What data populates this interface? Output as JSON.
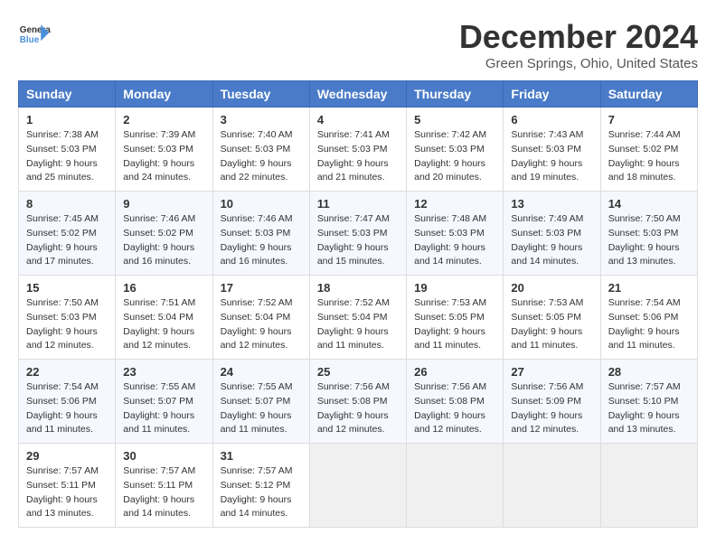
{
  "header": {
    "logo_general": "General",
    "logo_blue": "Blue",
    "month_title": "December 2024",
    "location": "Green Springs, Ohio, United States"
  },
  "days_of_week": [
    "Sunday",
    "Monday",
    "Tuesday",
    "Wednesday",
    "Thursday",
    "Friday",
    "Saturday"
  ],
  "weeks": [
    [
      {
        "day": "1",
        "sunrise": "7:38 AM",
        "sunset": "5:03 PM",
        "daylight": "9 hours and 25 minutes."
      },
      {
        "day": "2",
        "sunrise": "7:39 AM",
        "sunset": "5:03 PM",
        "daylight": "9 hours and 24 minutes."
      },
      {
        "day": "3",
        "sunrise": "7:40 AM",
        "sunset": "5:03 PM",
        "daylight": "9 hours and 22 minutes."
      },
      {
        "day": "4",
        "sunrise": "7:41 AM",
        "sunset": "5:03 PM",
        "daylight": "9 hours and 21 minutes."
      },
      {
        "day": "5",
        "sunrise": "7:42 AM",
        "sunset": "5:03 PM",
        "daylight": "9 hours and 20 minutes."
      },
      {
        "day": "6",
        "sunrise": "7:43 AM",
        "sunset": "5:03 PM",
        "daylight": "9 hours and 19 minutes."
      },
      {
        "day": "7",
        "sunrise": "7:44 AM",
        "sunset": "5:02 PM",
        "daylight": "9 hours and 18 minutes."
      }
    ],
    [
      {
        "day": "8",
        "sunrise": "7:45 AM",
        "sunset": "5:02 PM",
        "daylight": "9 hours and 17 minutes."
      },
      {
        "day": "9",
        "sunrise": "7:46 AM",
        "sunset": "5:02 PM",
        "daylight": "9 hours and 16 minutes."
      },
      {
        "day": "10",
        "sunrise": "7:46 AM",
        "sunset": "5:03 PM",
        "daylight": "9 hours and 16 minutes."
      },
      {
        "day": "11",
        "sunrise": "7:47 AM",
        "sunset": "5:03 PM",
        "daylight": "9 hours and 15 minutes."
      },
      {
        "day": "12",
        "sunrise": "7:48 AM",
        "sunset": "5:03 PM",
        "daylight": "9 hours and 14 minutes."
      },
      {
        "day": "13",
        "sunrise": "7:49 AM",
        "sunset": "5:03 PM",
        "daylight": "9 hours and 14 minutes."
      },
      {
        "day": "14",
        "sunrise": "7:50 AM",
        "sunset": "5:03 PM",
        "daylight": "9 hours and 13 minutes."
      }
    ],
    [
      {
        "day": "15",
        "sunrise": "7:50 AM",
        "sunset": "5:03 PM",
        "daylight": "9 hours and 12 minutes."
      },
      {
        "day": "16",
        "sunrise": "7:51 AM",
        "sunset": "5:04 PM",
        "daylight": "9 hours and 12 minutes."
      },
      {
        "day": "17",
        "sunrise": "7:52 AM",
        "sunset": "5:04 PM",
        "daylight": "9 hours and 12 minutes."
      },
      {
        "day": "18",
        "sunrise": "7:52 AM",
        "sunset": "5:04 PM",
        "daylight": "9 hours and 11 minutes."
      },
      {
        "day": "19",
        "sunrise": "7:53 AM",
        "sunset": "5:05 PM",
        "daylight": "9 hours and 11 minutes."
      },
      {
        "day": "20",
        "sunrise": "7:53 AM",
        "sunset": "5:05 PM",
        "daylight": "9 hours and 11 minutes."
      },
      {
        "day": "21",
        "sunrise": "7:54 AM",
        "sunset": "5:06 PM",
        "daylight": "9 hours and 11 minutes."
      }
    ],
    [
      {
        "day": "22",
        "sunrise": "7:54 AM",
        "sunset": "5:06 PM",
        "daylight": "9 hours and 11 minutes."
      },
      {
        "day": "23",
        "sunrise": "7:55 AM",
        "sunset": "5:07 PM",
        "daylight": "9 hours and 11 minutes."
      },
      {
        "day": "24",
        "sunrise": "7:55 AM",
        "sunset": "5:07 PM",
        "daylight": "9 hours and 11 minutes."
      },
      {
        "day": "25",
        "sunrise": "7:56 AM",
        "sunset": "5:08 PM",
        "daylight": "9 hours and 12 minutes."
      },
      {
        "day": "26",
        "sunrise": "7:56 AM",
        "sunset": "5:08 PM",
        "daylight": "9 hours and 12 minutes."
      },
      {
        "day": "27",
        "sunrise": "7:56 AM",
        "sunset": "5:09 PM",
        "daylight": "9 hours and 12 minutes."
      },
      {
        "day": "28",
        "sunrise": "7:57 AM",
        "sunset": "5:10 PM",
        "daylight": "9 hours and 13 minutes."
      }
    ],
    [
      {
        "day": "29",
        "sunrise": "7:57 AM",
        "sunset": "5:11 PM",
        "daylight": "9 hours and 13 minutes."
      },
      {
        "day": "30",
        "sunrise": "7:57 AM",
        "sunset": "5:11 PM",
        "daylight": "9 hours and 14 minutes."
      },
      {
        "day": "31",
        "sunrise": "7:57 AM",
        "sunset": "5:12 PM",
        "daylight": "9 hours and 14 minutes."
      },
      null,
      null,
      null,
      null
    ]
  ],
  "labels": {
    "sunrise": "Sunrise:",
    "sunset": "Sunset:",
    "daylight": "Daylight:"
  }
}
